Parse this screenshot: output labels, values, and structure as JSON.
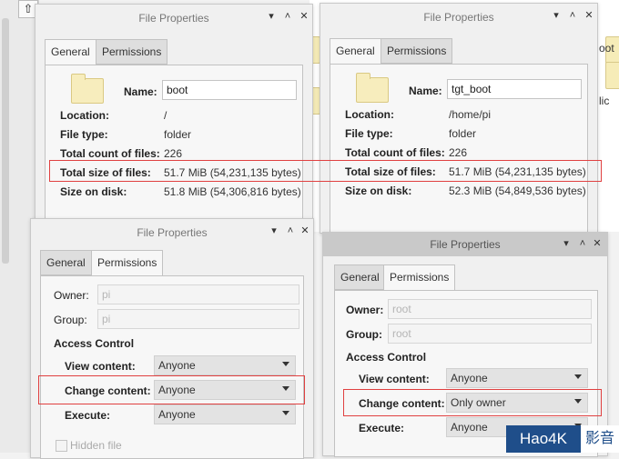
{
  "background": {
    "right_labels": [
      "oot",
      "lic"
    ]
  },
  "win1": {
    "title": "File Properties",
    "tabs": [
      "General",
      "Permissions"
    ],
    "name_label": "Name:",
    "name_value": "boot",
    "rows": [
      {
        "label": "Location:",
        "value": "/"
      },
      {
        "label": "File type:",
        "value": "folder"
      },
      {
        "label": "Total count of files:",
        "value": "226"
      },
      {
        "label": "Total size of files:",
        "value": "51.7 MiB (54,231,135 bytes)"
      },
      {
        "label": "Size on disk:",
        "value": "51.8 MiB (54,306,816 bytes)"
      }
    ]
  },
  "win2": {
    "title": "File Properties",
    "tabs": [
      "General",
      "Permissions"
    ],
    "name_label": "Name:",
    "name_value": "tgt_boot",
    "rows": [
      {
        "label": "Location:",
        "value": "/home/pi"
      },
      {
        "label": "File type:",
        "value": "folder"
      },
      {
        "label": "Total count of files:",
        "value": "226"
      },
      {
        "label": "Total size of files:",
        "value": "51.7 MiB (54,231,135 bytes)"
      },
      {
        "label": "Size on disk:",
        "value": "52.3 MiB (54,849,536 bytes)"
      }
    ]
  },
  "win3": {
    "title": "File Properties",
    "tabs": [
      "General",
      "Permissions"
    ],
    "owner_label": "Owner:",
    "owner_value": "pi",
    "group_label": "Group:",
    "group_value": "pi",
    "access_heading": "Access Control",
    "view_label": "View content:",
    "view_value": "Anyone",
    "change_label": "Change content:",
    "change_value": "Anyone",
    "exec_label": "Execute:",
    "exec_value": "Anyone",
    "hidden_label": "Hidden file"
  },
  "win4": {
    "title": "File Properties",
    "tabs": [
      "General",
      "Permissions"
    ],
    "owner_label": "Owner:",
    "owner_value": "root",
    "group_label": "Group:",
    "group_value": "root",
    "access_heading": "Access Control",
    "view_label": "View content:",
    "view_value": "Anyone",
    "change_label": "Change content:",
    "change_value": "Only owner",
    "exec_label": "Execute:",
    "exec_value": "Anyone"
  },
  "watermark": {
    "brand": "Hao4K",
    "suffix": "影音"
  },
  "colors": {
    "highlight": "#e04040",
    "watermark_bg": "#1f4e8a"
  }
}
